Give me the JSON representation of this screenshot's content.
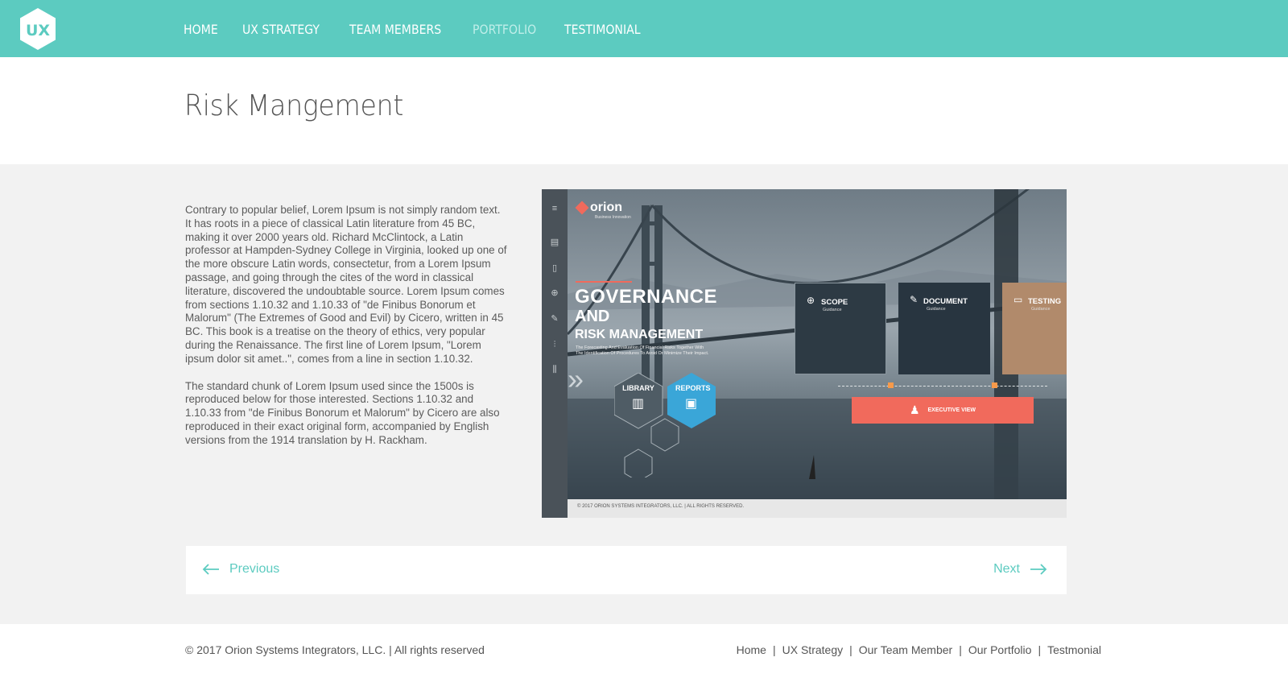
{
  "logo": {
    "text": "UX"
  },
  "nav": [
    {
      "label": "HOME",
      "active": false
    },
    {
      "label": "UX STRATEGY",
      "active": false
    },
    {
      "label": "TEAM MEMBERS",
      "active": false
    },
    {
      "label": "PORTFOLIO",
      "active": true
    },
    {
      "label": "TESTIMONIAL",
      "active": false
    }
  ],
  "page": {
    "title": "Risk Mangement"
  },
  "content": {
    "paragraphs": [
      "Contrary to popular belief, Lorem Ipsum is not simply random text. It has roots in a piece of classical Latin literature from 45 BC, making it over 2000 years old. Richard McClintock, a Latin professor at Hampden-Sydney College in Virginia, looked up one of the more obscure Latin words, consectetur, from a Lorem Ipsum passage, and going through the cites of the word in classical literature, discovered the undoubtable source. Lorem Ipsum comes from sections 1.10.32 and 1.10.33 of \"de Finibus Bonorum et Malorum\" (The Extremes of Good and Evil) by Cicero, written in 45 BC. This book is a treatise on the theory of ethics, very popular during the Renaissance. The first line of Lorem Ipsum, \"Lorem ipsum dolor sit amet..\", comes from a line in section 1.10.32.",
      "The standard chunk of Lorem Ipsum used since the 1500s is reproduced below for those interested. Sections 1.10.32 and 1.10.33 from \"de Finibus Bonorum et Malorum\" by Cicero are also reproduced in their exact original form, accompanied by English versions from the 1914 translation by H. Rackham."
    ]
  },
  "showcase": {
    "brand": "orion",
    "brand_sub": "Business Innovation",
    "headline_1": "GOVERNANCE",
    "headline_2": "AND",
    "headline_3": "RISK MANAGEMENT",
    "subtext_1": "The Forecasting And Evaluation Of Financial Risks Together With",
    "subtext_2": "The Identification Of Procedures To Avoid Or Minimize Their Impact.",
    "hex_library": "LIBRARY",
    "hex_reports": "REPORTS",
    "card_scope": "SCOPE",
    "card_document": "DOCUMENT",
    "card_testing": "TESTING",
    "card_guidance": "Guidance",
    "executive_button": "EXECUTIVE VIEW",
    "footer": "© 2017 ORION SYSTEMS INTEGRATORS, LLC. | ALL RIGHTS RESERVED.",
    "accent": "#f16a5c",
    "hex_blue": "#3aa6d8"
  },
  "pager": {
    "previous": "Previous",
    "next": "Next"
  },
  "footer": {
    "copyright": "© 2017 Orion Systems Integrators, LLC. | All rights reserved",
    "links": [
      "Home",
      "UX Strategy",
      "Our Team Member",
      "Our Portfolio",
      "Testmonial"
    ]
  },
  "colors": {
    "brand": "#5ccbc0",
    "background": "#f2f2f2"
  }
}
